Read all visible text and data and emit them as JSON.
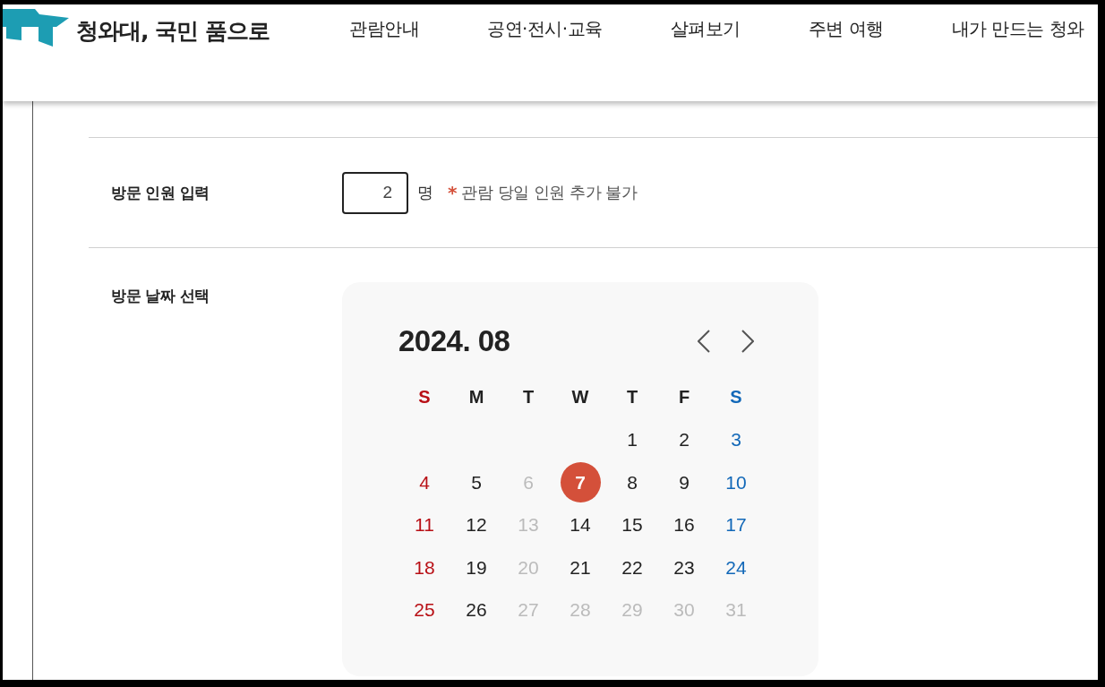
{
  "header": {
    "site_title": "청와대, 국민 품으로",
    "nav": [
      "관람안내",
      "공연·전시·교육",
      "살펴보기",
      "주변 여행",
      "내가 만드는 청와"
    ]
  },
  "visitors": {
    "label": "방문 인원 입력",
    "value": "2",
    "unit": "명",
    "note_mark": "*",
    "note": "관람 당일 인원 추가 불가"
  },
  "visit_date": {
    "label": "방문 날짜 선택",
    "calendar": {
      "title": "2024. 08",
      "weekdays": [
        "S",
        "M",
        "T",
        "W",
        "T",
        "F",
        "S"
      ],
      "weeks": [
        [
          {
            "day": "1",
            "disabled": false,
            "selected": false
          },
          {
            "day": "2",
            "disabled": false,
            "selected": false
          },
          {
            "day": "3",
            "disabled": false,
            "selected": false
          }
        ],
        [
          {
            "day": "4",
            "disabled": false,
            "selected": false
          },
          {
            "day": "5",
            "disabled": false,
            "selected": false
          },
          {
            "day": "6",
            "disabled": true,
            "selected": false
          },
          {
            "day": "7",
            "disabled": false,
            "selected": true
          },
          {
            "day": "8",
            "disabled": false,
            "selected": false
          },
          {
            "day": "9",
            "disabled": false,
            "selected": false
          },
          {
            "day": "10",
            "disabled": false,
            "selected": false
          }
        ],
        [
          {
            "day": "11",
            "disabled": false,
            "selected": false
          },
          {
            "day": "12",
            "disabled": false,
            "selected": false
          },
          {
            "day": "13",
            "disabled": true,
            "selected": false
          },
          {
            "day": "14",
            "disabled": false,
            "selected": false
          },
          {
            "day": "15",
            "disabled": false,
            "selected": false
          },
          {
            "day": "16",
            "disabled": false,
            "selected": false
          },
          {
            "day": "17",
            "disabled": false,
            "selected": false
          }
        ],
        [
          {
            "day": "18",
            "disabled": false,
            "selected": false
          },
          {
            "day": "19",
            "disabled": false,
            "selected": false
          },
          {
            "day": "20",
            "disabled": true,
            "selected": false
          },
          {
            "day": "21",
            "disabled": false,
            "selected": false
          },
          {
            "day": "22",
            "disabled": false,
            "selected": false
          },
          {
            "day": "23",
            "disabled": false,
            "selected": false
          },
          {
            "day": "24",
            "disabled": false,
            "selected": false
          }
        ],
        [
          {
            "day": "25",
            "disabled": false,
            "selected": false
          },
          {
            "day": "26",
            "disabled": false,
            "selected": false
          },
          {
            "day": "27",
            "disabled": true,
            "selected": false
          },
          {
            "day": "28",
            "disabled": true,
            "selected": false
          },
          {
            "day": "29",
            "disabled": true,
            "selected": false
          },
          {
            "day": "30",
            "disabled": true,
            "selected": false
          },
          {
            "day": "31",
            "disabled": true,
            "selected": false
          }
        ]
      ]
    }
  }
}
